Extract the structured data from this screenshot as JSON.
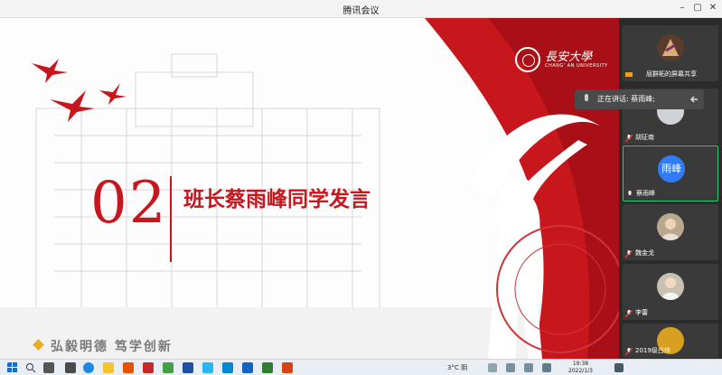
{
  "window": {
    "title": "腾讯会议"
  },
  "slide": {
    "number": "02",
    "title": "班长蔡雨峰同学发言",
    "motto": "弘毅明德  笃学创新",
    "university_name": "長安大學",
    "university_en": "CHANG' AN UNIVERSITY",
    "watermark_text": "AN UNIVE"
  },
  "speaking_tooltip": {
    "text": "正在讲话: 蔡雨峰;"
  },
  "participants": [
    {
      "name": "屈群柘的屏幕共享",
      "active": false
    },
    {
      "name": "胡征南",
      "active": false
    },
    {
      "name": "蔡雨峰",
      "avatar_text": "雨峰",
      "active": true
    },
    {
      "name": "魏金戈",
      "active": false
    },
    {
      "name": "李蕾",
      "active": false
    },
    {
      "name": "2019级白帅",
      "active": false
    }
  ],
  "taskbar": {
    "weather": "3°C 阴",
    "time": "19:38",
    "date": "2022/1/3"
  },
  "colors": {
    "accent_red": "#c8161d",
    "panel_bg": "#2b2b2b",
    "active_green": "#2ecc71"
  }
}
